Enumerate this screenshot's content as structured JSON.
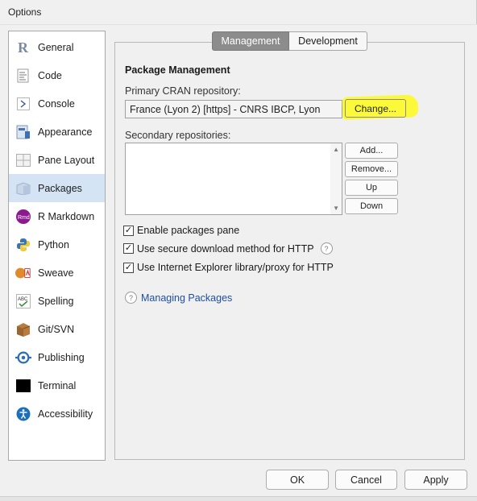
{
  "window": {
    "title": "Options"
  },
  "sidebar": {
    "items": [
      {
        "label": "General",
        "icon": "r-logo-icon"
      },
      {
        "label": "Code",
        "icon": "code-document-icon"
      },
      {
        "label": "Console",
        "icon": "console-prompt-icon"
      },
      {
        "label": "Appearance",
        "icon": "appearance-icon"
      },
      {
        "label": "Pane Layout",
        "icon": "pane-layout-icon"
      },
      {
        "label": "Packages",
        "icon": "packages-icon",
        "selected": true
      },
      {
        "label": "R Markdown",
        "icon": "rmarkdown-icon"
      },
      {
        "label": "Python",
        "icon": "python-icon"
      },
      {
        "label": "Sweave",
        "icon": "sweave-icon"
      },
      {
        "label": "Spelling",
        "icon": "spelling-icon"
      },
      {
        "label": "Git/SVN",
        "icon": "git-svn-icon"
      },
      {
        "label": "Publishing",
        "icon": "publishing-icon"
      },
      {
        "label": "Terminal",
        "icon": "terminal-icon"
      },
      {
        "label": "Accessibility",
        "icon": "accessibility-icon"
      }
    ]
  },
  "tabs": [
    {
      "label": "Management",
      "active": true
    },
    {
      "label": "Development",
      "active": false
    }
  ],
  "packages": {
    "section_title": "Package Management",
    "primary_label": "Primary CRAN repository:",
    "primary_value": "France (Lyon 2) [https] - CNRS IBCP, Lyon",
    "change_label": "Change...",
    "secondary_label": "Secondary repositories:",
    "buttons": {
      "add": "Add...",
      "remove": "Remove...",
      "up": "Up",
      "down": "Down"
    },
    "checkboxes": [
      {
        "label": "Enable packages pane",
        "checked": true,
        "help": false
      },
      {
        "label": "Use secure download method for HTTP",
        "checked": true,
        "help": true
      },
      {
        "label": "Use Internet Explorer library/proxy for HTTP",
        "checked": true,
        "help": false
      }
    ],
    "help_link": "Managing Packages"
  },
  "footer": {
    "ok": "OK",
    "cancel": "Cancel",
    "apply": "Apply"
  },
  "colors": {
    "highlight": "#fbf93a",
    "selected": "#d4e4f4",
    "link": "#1f4ea6",
    "active_tab": "#8c8c8c"
  }
}
